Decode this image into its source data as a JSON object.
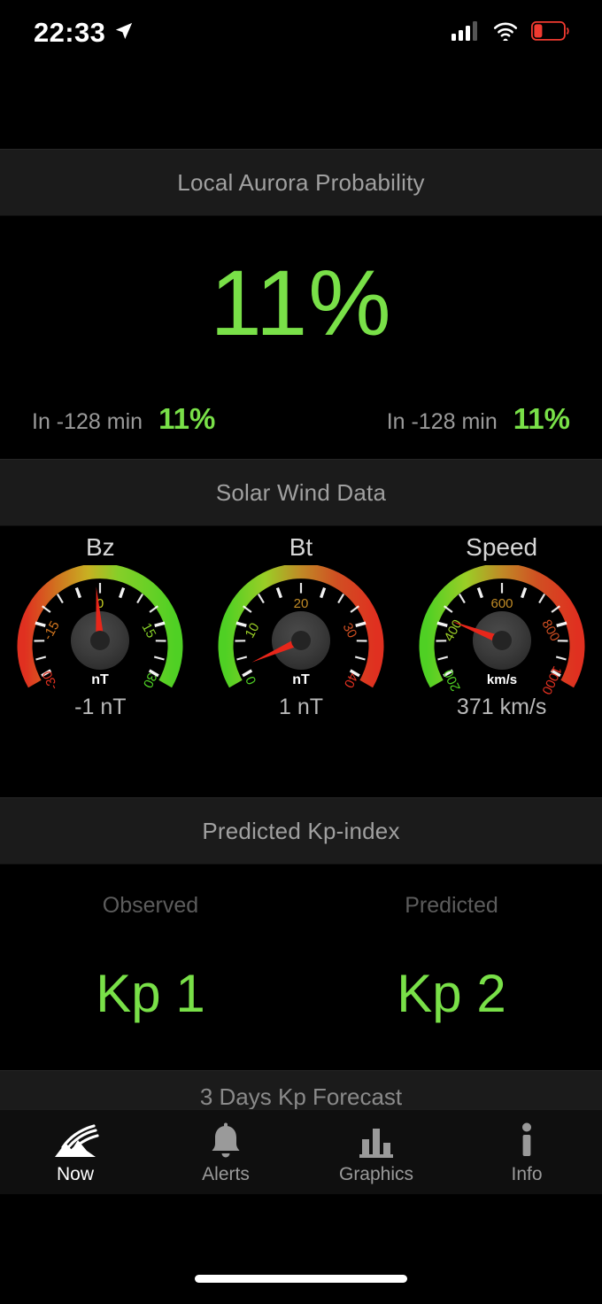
{
  "status_bar": {
    "time": "22:33",
    "location_icon": "location-arrow-icon",
    "signal_icon": "cellular-signal-icon",
    "wifi_icon": "wifi-icon",
    "battery_icon": "battery-low-icon",
    "battery_color": "#f03a30",
    "signal_bars_filled": 3,
    "signal_bars_total": 4
  },
  "sections": {
    "aurora": {
      "title": "Local Aurora Probability"
    },
    "solar_wind": {
      "title": "Solar Wind Data"
    },
    "kp": {
      "title": "Predicted Kp-index"
    },
    "forecast": {
      "title": "3 Days Kp Forecast"
    }
  },
  "aurora": {
    "current_value": "11%",
    "left": {
      "label": "In -128 min",
      "value": "11%"
    },
    "right": {
      "label": "In -128 min",
      "value": "11%"
    },
    "accent_color": "#79e048"
  },
  "kp": {
    "observed_label": "Observed",
    "predicted_label": "Predicted",
    "observed_value": "Kp 1",
    "predicted_value": "Kp 2",
    "accent_color": "#79e048"
  },
  "tabs": [
    {
      "id": "now",
      "label": "Now",
      "icon": "aurora-icon",
      "active": true
    },
    {
      "id": "alerts",
      "label": "Alerts",
      "icon": "bell-icon",
      "active": false
    },
    {
      "id": "graphics",
      "label": "Graphics",
      "icon": "bar-chart-icon",
      "active": false
    },
    {
      "id": "info",
      "label": "Info",
      "icon": "info-icon",
      "active": false
    }
  ],
  "chart_data": [
    {
      "type": "gauge",
      "title": "Bz",
      "unit": "nT",
      "value": -1,
      "display_value": "-1 nT",
      "min": -30,
      "max": 30,
      "ticks": [
        -30,
        -15,
        0,
        15,
        30
      ],
      "tick_labels": [
        "-30",
        "-15",
        "0",
        "15",
        "30"
      ],
      "color_stops": [
        "#e03020",
        "#d98a20",
        "#cfd024",
        "#6fd02a",
        "#57d024"
      ],
      "needle_color": "#e8261a"
    },
    {
      "type": "gauge",
      "title": "Bt",
      "unit": "nT",
      "value": 1,
      "display_value": "1 nT",
      "min": 0,
      "max": 40,
      "ticks": [
        0,
        10,
        20,
        30,
        40
      ],
      "tick_labels": [
        "0",
        "10",
        "20",
        "30",
        "40"
      ],
      "color_stops": [
        "#57d024",
        "#9ace26",
        "#c39a26",
        "#d05a22",
        "#e03020"
      ],
      "needle_color": "#e8261a"
    },
    {
      "type": "gauge",
      "title": "Speed",
      "unit": "km/s",
      "value": 371,
      "display_value": "371 km/s",
      "min": 200,
      "max": 1000,
      "ticks": [
        200,
        400,
        600,
        800,
        1000
      ],
      "tick_labels": [
        "200",
        "400",
        "600",
        "800",
        "1000"
      ],
      "color_stops": [
        "#57d024",
        "#9ace26",
        "#c39a26",
        "#d05a22",
        "#e03020"
      ],
      "needle_color": "#e8261a"
    }
  ]
}
